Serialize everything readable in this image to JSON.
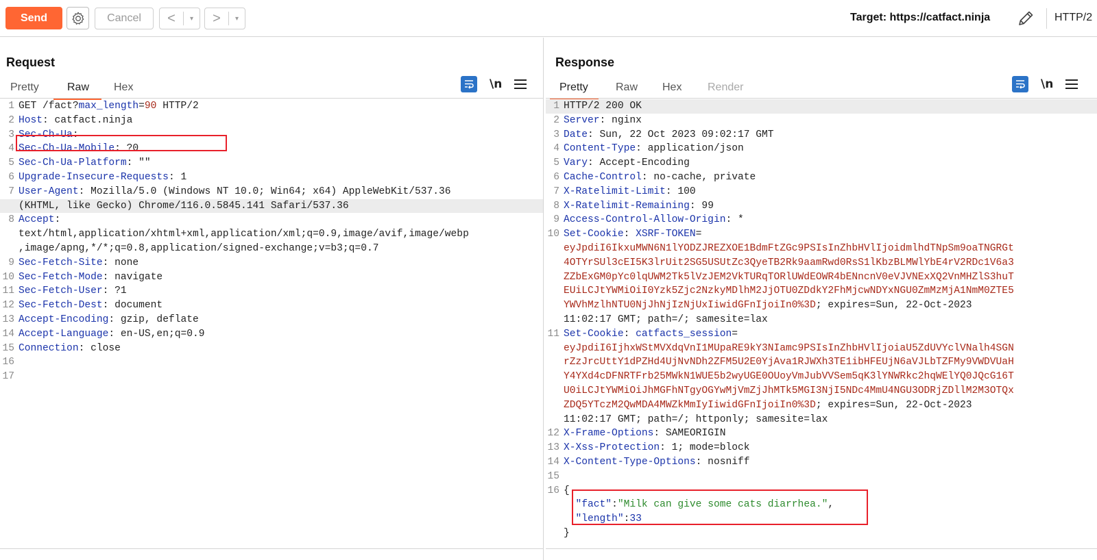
{
  "toolbar": {
    "send_label": "Send",
    "cancel_label": "Cancel",
    "back_arrow": "<",
    "forward_arrow": ">",
    "dropdown_glyph": "▾",
    "target_label": "Target: https://catfact.ninja",
    "http_version": "HTTP/2"
  },
  "colors": {
    "accent": "#ff6633",
    "active_blue": "#2b73c7",
    "highlight_box": "#e8202a",
    "header_key": "#1a33aa",
    "cookie_value": "#a82a1a",
    "json_string": "#2e8b2e"
  },
  "request": {
    "title": "Request",
    "tabs": [
      {
        "label": "Pretty",
        "active": false
      },
      {
        "label": "Raw",
        "active": true
      },
      {
        "label": "Hex",
        "active": false
      }
    ],
    "lines": [
      {
        "num": "1",
        "segments": [
          {
            "t": "GET /fact?",
            "c": "v"
          },
          {
            "t": "max_length",
            "c": "k"
          },
          {
            "t": "=",
            "c": "v"
          },
          {
            "t": "90",
            "c": "q"
          },
          {
            "t": " HTTP/2",
            "c": "v"
          }
        ]
      },
      {
        "num": "2",
        "segments": [
          {
            "t": "Host",
            "c": "k"
          },
          {
            "t": ": catfact.ninja",
            "c": "v"
          }
        ]
      },
      {
        "num": "3",
        "segments": [
          {
            "t": "Sec-Ch-Ua",
            "c": "k"
          },
          {
            "t": ":",
            "c": "v"
          }
        ]
      },
      {
        "num": "4",
        "segments": [
          {
            "t": "Sec-Ch-Ua-Mobile",
            "c": "k"
          },
          {
            "t": ": ?0",
            "c": "v"
          }
        ]
      },
      {
        "num": "5",
        "segments": [
          {
            "t": "Sec-Ch-Ua-Platform",
            "c": "k"
          },
          {
            "t": ": \"\"",
            "c": "v"
          }
        ]
      },
      {
        "num": "6",
        "segments": [
          {
            "t": "Upgrade-Insecure-Requests",
            "c": "k"
          },
          {
            "t": ": 1",
            "c": "v"
          }
        ]
      },
      {
        "num": "7",
        "segments": [
          {
            "t": "User-Agent",
            "c": "k"
          },
          {
            "t": ": Mozilla/5.0 (Windows NT 10.0; Win64; x64) AppleWebKit/537.36",
            "c": "v"
          }
        ]
      },
      {
        "num": "",
        "hl": true,
        "segments": [
          {
            "t": "(KHTML, like Gecko) Chrome/116.0.5845.141 Safari/537.36",
            "c": "v"
          }
        ]
      },
      {
        "num": "8",
        "segments": [
          {
            "t": "Accept",
            "c": "k"
          },
          {
            "t": ":",
            "c": "v"
          }
        ]
      },
      {
        "num": "",
        "segments": [
          {
            "t": "text/html,application/xhtml+xml,application/xml;q=0.9,image/avif,image/webp",
            "c": "v"
          }
        ]
      },
      {
        "num": "",
        "segments": [
          {
            "t": ",image/apng,*/*;q=0.8,application/signed-exchange;v=b3;q=0.7",
            "c": "v"
          }
        ]
      },
      {
        "num": "9",
        "segments": [
          {
            "t": "Sec-Fetch-Site",
            "c": "k"
          },
          {
            "t": ": none",
            "c": "v"
          }
        ]
      },
      {
        "num": "10",
        "segments": [
          {
            "t": "Sec-Fetch-Mode",
            "c": "k"
          },
          {
            "t": ": navigate",
            "c": "v"
          }
        ]
      },
      {
        "num": "11",
        "segments": [
          {
            "t": "Sec-Fetch-User",
            "c": "k"
          },
          {
            "t": ": ?1",
            "c": "v"
          }
        ]
      },
      {
        "num": "12",
        "segments": [
          {
            "t": "Sec-Fetch-Dest",
            "c": "k"
          },
          {
            "t": ": document",
            "c": "v"
          }
        ]
      },
      {
        "num": "13",
        "segments": [
          {
            "t": "Accept-Encoding",
            "c": "k"
          },
          {
            "t": ": gzip, deflate",
            "c": "v"
          }
        ]
      },
      {
        "num": "14",
        "segments": [
          {
            "t": "Accept-Language",
            "c": "k"
          },
          {
            "t": ": en-US,en;q=0.9",
            "c": "v"
          }
        ]
      },
      {
        "num": "15",
        "segments": [
          {
            "t": "Connection",
            "c": "k"
          },
          {
            "t": ": close",
            "c": "v"
          }
        ]
      },
      {
        "num": "16",
        "segments": []
      },
      {
        "num": "17",
        "segments": []
      }
    ]
  },
  "response": {
    "title": "Response",
    "tabs": [
      {
        "label": "Pretty",
        "active": true
      },
      {
        "label": "Raw",
        "active": false
      },
      {
        "label": "Hex",
        "active": false
      },
      {
        "label": "Render",
        "active": false,
        "disabled": true
      }
    ],
    "lines": [
      {
        "num": "1",
        "hl": true,
        "segments": [
          {
            "t": "HTTP/2 200 OK",
            "c": "v"
          }
        ]
      },
      {
        "num": "2",
        "segments": [
          {
            "t": "Server",
            "c": "k"
          },
          {
            "t": ": nginx",
            "c": "v"
          }
        ]
      },
      {
        "num": "3",
        "segments": [
          {
            "t": "Date",
            "c": "k"
          },
          {
            "t": ": Sun, 22 Oct 2023 09:02:17 GMT",
            "c": "v"
          }
        ]
      },
      {
        "num": "4",
        "segments": [
          {
            "t": "Content-Type",
            "c": "k"
          },
          {
            "t": ": application/json",
            "c": "v"
          }
        ]
      },
      {
        "num": "5",
        "segments": [
          {
            "t": "Vary",
            "c": "k"
          },
          {
            "t": ": Accept-Encoding",
            "c": "v"
          }
        ]
      },
      {
        "num": "6",
        "segments": [
          {
            "t": "Cache-Control",
            "c": "k"
          },
          {
            "t": ": no-cache, private",
            "c": "v"
          }
        ]
      },
      {
        "num": "7",
        "segments": [
          {
            "t": "X-Ratelimit-Limit",
            "c": "k"
          },
          {
            "t": ": 100",
            "c": "v"
          }
        ]
      },
      {
        "num": "8",
        "segments": [
          {
            "t": "X-Ratelimit-Remaining",
            "c": "k"
          },
          {
            "t": ": 99",
            "c": "v"
          }
        ]
      },
      {
        "num": "9",
        "segments": [
          {
            "t": "Access-Control-Allow-Origin",
            "c": "k"
          },
          {
            "t": ": *",
            "c": "v"
          }
        ]
      },
      {
        "num": "10",
        "segments": [
          {
            "t": "Set-Cookie",
            "c": "k"
          },
          {
            "t": ": ",
            "c": "v"
          },
          {
            "t": "XSRF-TOKEN",
            "c": "k"
          },
          {
            "t": "=",
            "c": "v"
          }
        ]
      },
      {
        "num": "",
        "segments": [
          {
            "t": "eyJpdiI6IkxuMWN6N1lYODZJREZXOE1BdmFtZGc9PSIsInZhbHVlIjoidmlhdTNpSm9oaTNGRGt",
            "c": "q"
          }
        ]
      },
      {
        "num": "",
        "segments": [
          {
            "t": "4OTYrSUl3cEI5K3lrUit2SG5USUtZc3QyeTB2Rk9aamRwd0RsS1lKbzBLMWlYbE4rV2RDc1V6a3",
            "c": "q"
          }
        ]
      },
      {
        "num": "",
        "segments": [
          {
            "t": "ZZbExGM0pYc0lqUWM2Tk5lVzJEM2VkTURqTORlUWdEOWR4bENncnV0eVJVNExXQ2VnMHZlS3huT",
            "c": "q"
          }
        ]
      },
      {
        "num": "",
        "segments": [
          {
            "t": "EUiLCJtYWMiOiI0Yzk5Zjc2NzkyMDlhM2JjOTU0ZDdkY2FhMjcwNDYxNGU0ZmMzMjA1NmM0ZTE5",
            "c": "q"
          }
        ]
      },
      {
        "num": "",
        "segments": [
          {
            "t": "YWVhMzlhNTU0NjJhNjIzNjUxIiwidGFnIjoiIn0%3D",
            "c": "q"
          },
          {
            "t": "; expires=Sun, 22-Oct-2023",
            "c": "v"
          }
        ]
      },
      {
        "num": "",
        "segments": [
          {
            "t": "11:02:17 GMT; path=/; samesite=lax",
            "c": "v"
          }
        ]
      },
      {
        "num": "11",
        "segments": [
          {
            "t": "Set-Cookie",
            "c": "k"
          },
          {
            "t": ": ",
            "c": "v"
          },
          {
            "t": "catfacts_session",
            "c": "k"
          },
          {
            "t": "=",
            "c": "v"
          }
        ]
      },
      {
        "num": "",
        "segments": [
          {
            "t": "eyJpdiI6IjhxWStMVXdqVnI1MUpaRE9kY3NIamc9PSIsInZhbHVlIjoiaU5ZdUVYclVNalh4SGN",
            "c": "q"
          }
        ]
      },
      {
        "num": "",
        "segments": [
          {
            "t": "rZzJrcUttY1dPZHd4UjNvNDh2ZFM5U2E0YjAva1RJWXh3TE1ibHFEUjN6aVJLbTZFMy9VWDVUaH",
            "c": "q"
          }
        ]
      },
      {
        "num": "",
        "segments": [
          {
            "t": "Y4YXd4cDFNRTFrb25MWkN1WUE5b2wyUGE0OUoyVmJubVVSem5qK3lYNWRkc2hqWElYQ0JQcG16T",
            "c": "q"
          }
        ]
      },
      {
        "num": "",
        "segments": [
          {
            "t": "U0iLCJtYWMiOiJhMGFhNTgyOGYwMjVmZjJhMTk5MGI3NjI5NDc4MmU4NGU3ODRjZDllM2M3OTQx",
            "c": "q"
          }
        ]
      },
      {
        "num": "",
        "segments": [
          {
            "t": "ZDQ5YTczM2QwMDA4MWZkMmIyIiwidGFnIjoiIn0%3D",
            "c": "q"
          },
          {
            "t": "; expires=Sun, 22-Oct-2023",
            "c": "v"
          }
        ]
      },
      {
        "num": "",
        "segments": [
          {
            "t": "11:02:17 GMT; path=/; httponly; samesite=lax",
            "c": "v"
          }
        ]
      },
      {
        "num": "12",
        "segments": [
          {
            "t": "X-Frame-Options",
            "c": "k"
          },
          {
            "t": ": SAMEORIGIN",
            "c": "v"
          }
        ]
      },
      {
        "num": "13",
        "segments": [
          {
            "t": "X-Xss-Protection",
            "c": "k"
          },
          {
            "t": ": 1; mode=block",
            "c": "v"
          }
        ]
      },
      {
        "num": "14",
        "segments": [
          {
            "t": "X-Content-Type-Options",
            "c": "k"
          },
          {
            "t": ": nosniff",
            "c": "v"
          }
        ]
      },
      {
        "num": "15",
        "segments": []
      },
      {
        "num": "16",
        "segments": [
          {
            "t": "{",
            "c": "v"
          }
        ]
      },
      {
        "num": "",
        "segments": [
          {
            "t": "  ",
            "c": "v"
          },
          {
            "t": "\"fact\"",
            "c": "jkey"
          },
          {
            "t": ":",
            "c": "v"
          },
          {
            "t": "\"Milk can give some cats diarrhea.\"",
            "c": "jstr"
          },
          {
            "t": ",",
            "c": "v"
          }
        ]
      },
      {
        "num": "",
        "segments": [
          {
            "t": "  ",
            "c": "v"
          },
          {
            "t": "\"length\"",
            "c": "jkey"
          },
          {
            "t": ":",
            "c": "v"
          },
          {
            "t": "33",
            "c": "jnum"
          }
        ]
      },
      {
        "num": "",
        "segments": [
          {
            "t": "}",
            "c": "v"
          }
        ]
      }
    ]
  }
}
